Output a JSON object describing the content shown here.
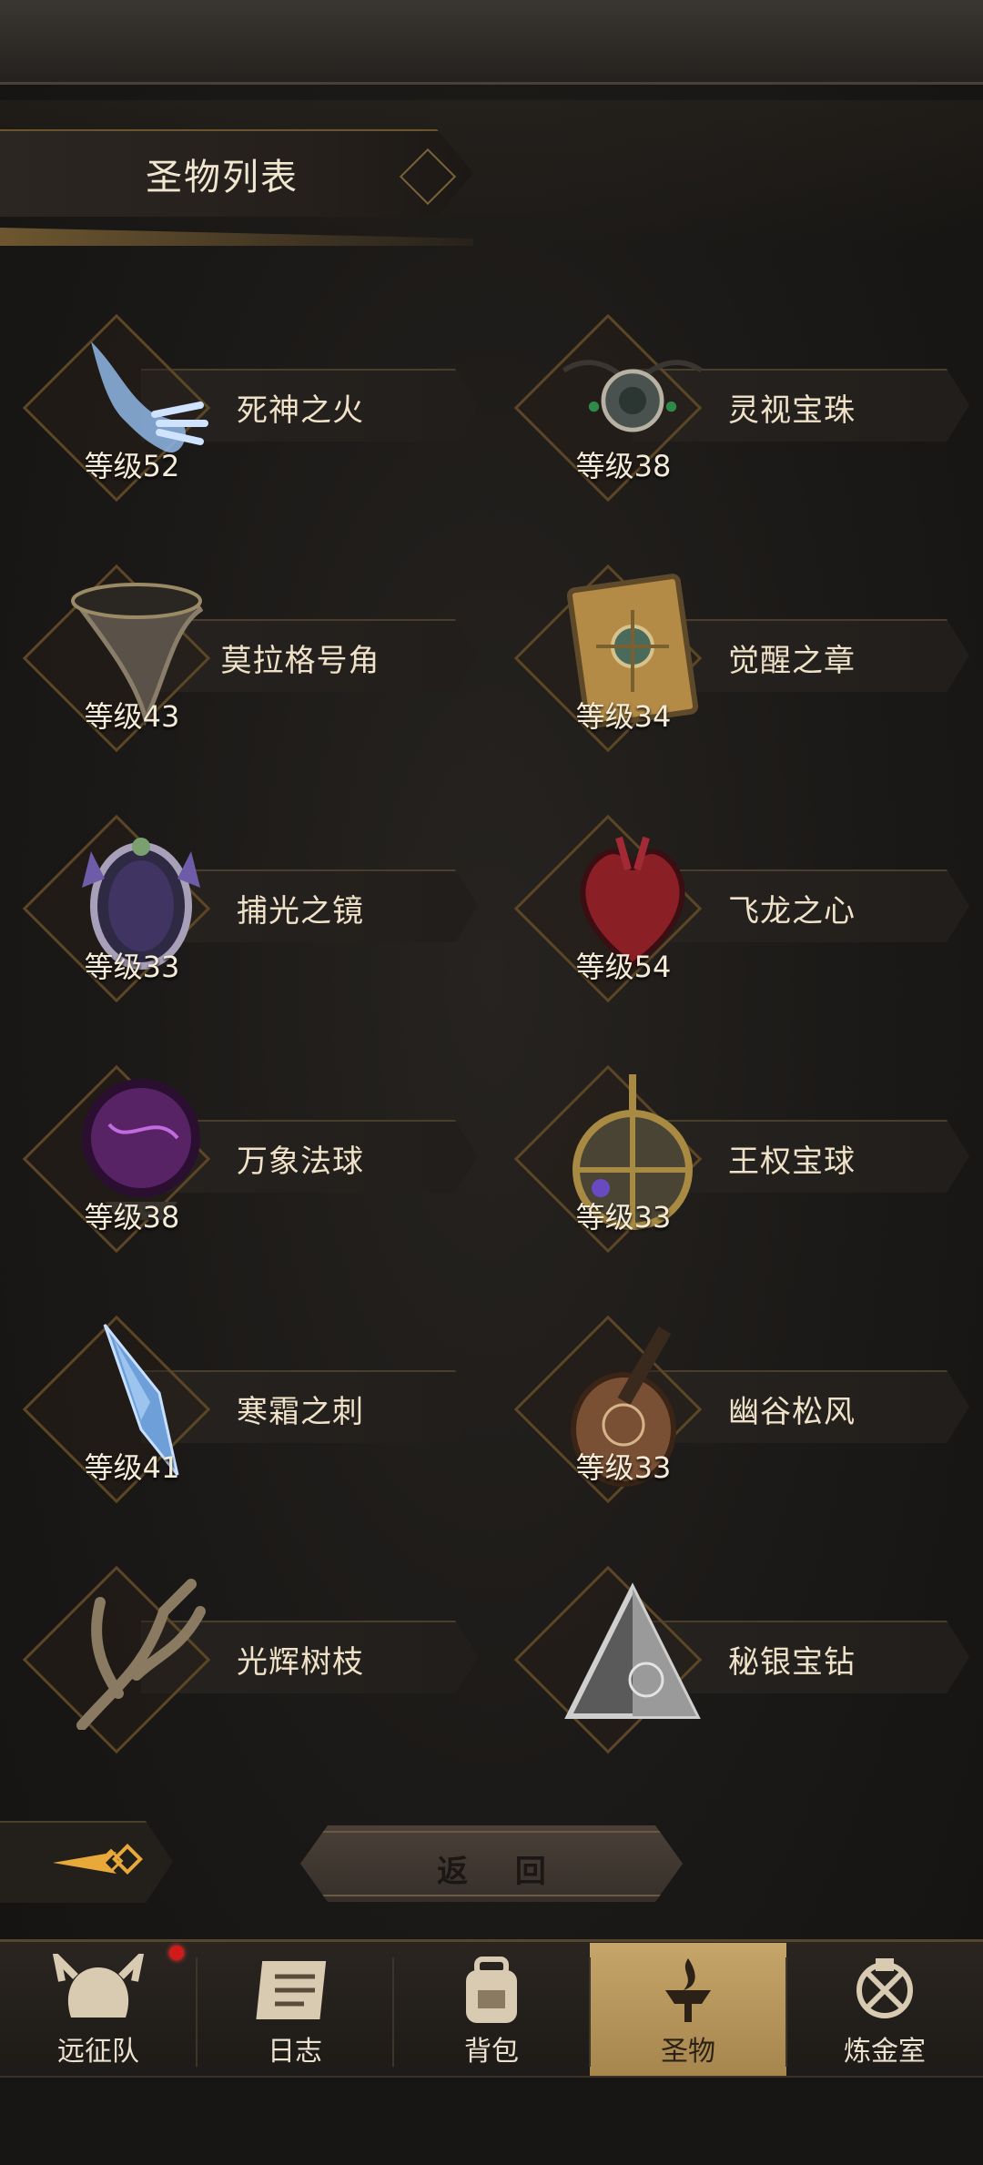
{
  "header": {
    "title": "圣物列表"
  },
  "level_prefix": "等级",
  "relics": [
    {
      "name": "死神之火",
      "level": "等级52",
      "icon": "spectral-hand-icon",
      "color": "#8fb7e6"
    },
    {
      "name": "灵视宝珠",
      "level": "等级38",
      "icon": "gem-amulet-icon",
      "color": "#7f8a86"
    },
    {
      "name": "莫拉格号角",
      "level": "等级43",
      "icon": "horn-icon",
      "color": "#5a5248"
    },
    {
      "name": "觉醒之章",
      "level": "等级34",
      "icon": "ornate-book-icon",
      "color": "#b38b46"
    },
    {
      "name": "捕光之镜",
      "level": "等级33",
      "icon": "crystal-mirror-icon",
      "color": "#6e5ca8"
    },
    {
      "name": "飞龙之心",
      "level": "等级54",
      "icon": "dragon-heart-icon",
      "color": "#8a1f26"
    },
    {
      "name": "万象法球",
      "level": "等级38",
      "icon": "dark-orb-icon",
      "color": "#6b2c7a"
    },
    {
      "name": "王权宝球",
      "level": "等级33",
      "icon": "royal-orb-icon",
      "color": "#a88a42"
    },
    {
      "name": "寒霜之刺",
      "level": "等级41",
      "icon": "ice-shard-icon",
      "color": "#6f9fd8"
    },
    {
      "name": "幽谷松风",
      "level": "等级33",
      "icon": "lute-icon",
      "color": "#7a5034"
    },
    {
      "name": "光辉树枝",
      "level": "",
      "icon": "branch-icon",
      "color": "#8a7a62"
    },
    {
      "name": "秘银宝钻",
      "level": "",
      "icon": "mithril-pyramid-icon",
      "color": "#9a9a9a"
    }
  ],
  "return_button": {
    "label": "返 回"
  },
  "nav": {
    "tabs": [
      {
        "label": "远征队",
        "icon": "viking-helmet-icon",
        "active": false,
        "has_badge": true
      },
      {
        "label": "日志",
        "icon": "scroll-icon",
        "active": false,
        "has_badge": false
      },
      {
        "label": "背包",
        "icon": "backpack-icon",
        "active": false,
        "has_badge": false
      },
      {
        "label": "圣物",
        "icon": "brazier-icon",
        "active": true,
        "has_badge": false
      },
      {
        "label": "炼金室",
        "icon": "alchemy-icon",
        "active": false,
        "has_badge": false
      }
    ]
  },
  "colors": {
    "accent_gold": "#b9965a",
    "badge_red": "#d11a1a"
  }
}
